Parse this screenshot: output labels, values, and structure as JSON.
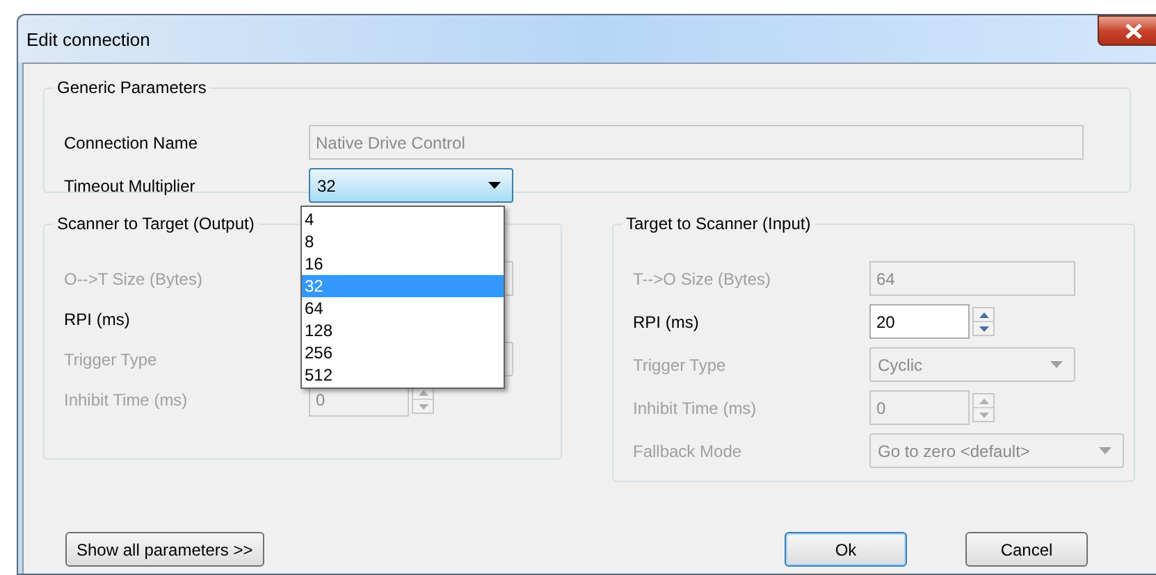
{
  "window": {
    "title": "Edit connection"
  },
  "generic": {
    "title": "Generic Parameters",
    "fields": [
      {
        "label": "Connection Name",
        "kind": "text",
        "value": "Native Drive Control",
        "disabled": false,
        "readonly": true
      },
      {
        "label": "Timeout Multiplier",
        "kind": "combo",
        "value": "32",
        "disabled": false,
        "expanded": true
      }
    ]
  },
  "timeout_options": [
    {
      "label": "4",
      "selected": false
    },
    {
      "label": "8",
      "selected": false
    },
    {
      "label": "16",
      "selected": false
    },
    {
      "label": "32",
      "selected": true
    },
    {
      "label": "64",
      "selected": false
    },
    {
      "label": "128",
      "selected": false
    },
    {
      "label": "256",
      "selected": false
    },
    {
      "label": "512",
      "selected": false
    }
  ],
  "output": {
    "title": "Scanner to Target (Output)",
    "fields": [
      {
        "label": "O-->T Size (Bytes)",
        "kind": "text",
        "disabled": true
      },
      {
        "label": "RPI (ms)",
        "disabled": false
      },
      {
        "label": "Trigger Type",
        "kind": "combo",
        "disabled": true
      },
      {
        "label": "Inhibit Time (ms)",
        "kind": "spin",
        "value": "0",
        "disabled": true
      }
    ]
  },
  "input": {
    "title": "Target to Scanner (Input)",
    "fields": [
      {
        "label": "T-->O Size (Bytes)",
        "kind": "text",
        "value": "64",
        "disabled": true
      },
      {
        "label": "RPI (ms)",
        "kind": "spin",
        "value": "20",
        "disabled": false
      },
      {
        "label": "Trigger Type",
        "kind": "combo",
        "value": "Cyclic",
        "disabled": true
      },
      {
        "label": "Inhibit Time (ms)",
        "kind": "spin",
        "value": "0",
        "disabled": true
      },
      {
        "label": "Fallback Mode",
        "kind": "combo",
        "value": "Go to zero <default>",
        "disabled": true
      }
    ]
  },
  "footer": {
    "left_button": {
      "label": "Show all parameters >>",
      "default": false
    },
    "buttons": [
      {
        "label": "Ok",
        "default": true
      },
      {
        "label": "Cancel",
        "default": false
      }
    ]
  }
}
